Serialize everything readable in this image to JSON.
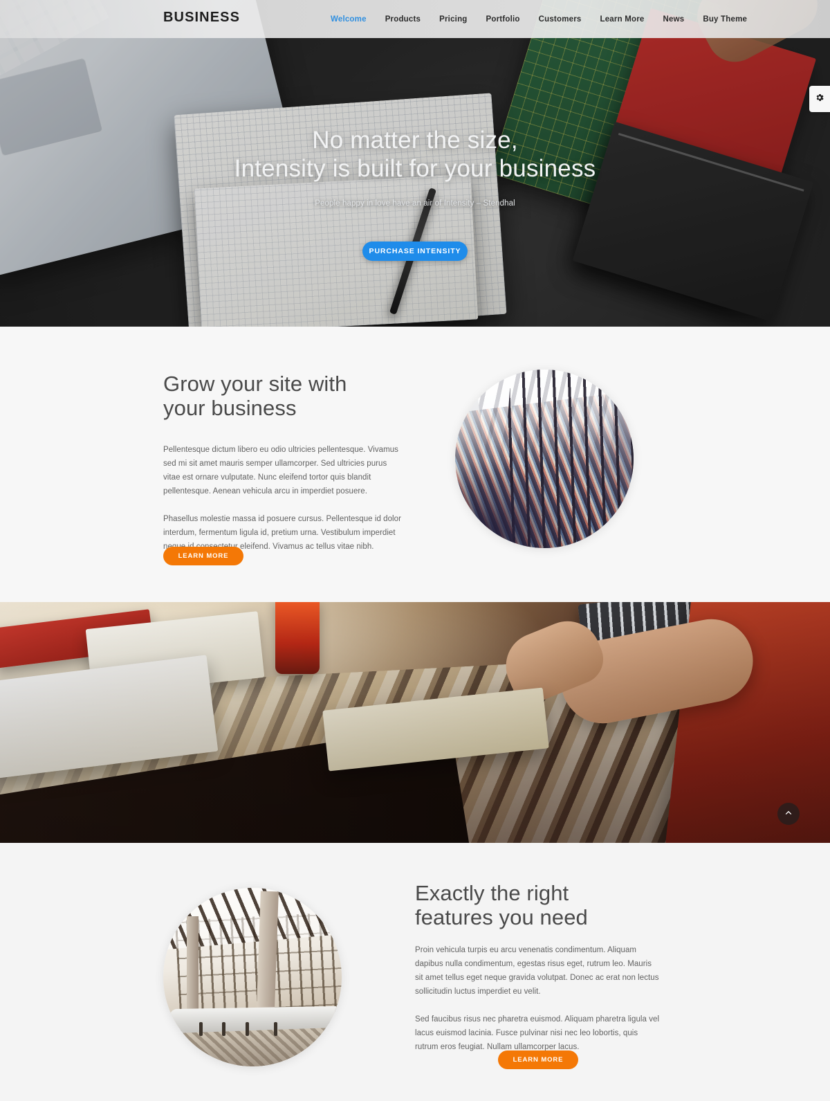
{
  "header": {
    "brand": "BUSINESS",
    "nav": [
      {
        "label": "Welcome",
        "active": true
      },
      {
        "label": "Products",
        "active": false
      },
      {
        "label": "Pricing",
        "active": false
      },
      {
        "label": "Portfolio",
        "active": false
      },
      {
        "label": "Customers",
        "active": false
      },
      {
        "label": "Learn More",
        "active": false
      },
      {
        "label": "News",
        "active": false
      },
      {
        "label": "Buy Theme",
        "active": false
      }
    ]
  },
  "hero": {
    "title_line1": "No matter the size,",
    "title_line2": "Intensity is built for your business",
    "subtitle": "People happy in love have an air of Intensity – Stendhal",
    "cta_label": "PURCHASE INTENSITY"
  },
  "settings": {
    "icon": "gear-icon"
  },
  "scroll_top": {
    "icon": "chevron-up-icon"
  },
  "grow": {
    "heading_line1": "Grow your site with",
    "heading_line2": "your business",
    "paragraph1": "Pellentesque dictum libero eu odio ultricies pellentesque. Vivamus sed mi sit amet mauris semper ullamcorper. Sed ultricies purus vitae est ornare vulputate. Nunc eleifend tortor quis blandit pellentesque. Aenean vehicula arcu in imperdiet posuere.",
    "paragraph2": "Phasellus molestie massa id posuere cursus. Pellentesque id dolor interdum, fermentum ligula id, pretium urna. Vestibulum imperdiet neque id consectetur eleifend. Vivamus ac tellus vitae nibh.",
    "cta_label": "LEARN MORE",
    "image_alt": "library-photo"
  },
  "band": {
    "image_alt": "desk-workspace-photo"
  },
  "features": {
    "heading_line1": "Exactly the right",
    "heading_line2": "features you need",
    "paragraph1": "Proin vehicula turpis eu arcu venenatis condimentum. Aliquam dapibus nulla condimentum, egestas risus eget, rutrum leo. Mauris sit amet tellus eget neque gravida volutpat. Donec ac erat non lectus sollicitudin luctus imperdiet eu velit.",
    "paragraph2": "Sed faucibus risus nec pharetra euismod. Aliquam pharetra ligula vel lacus euismod lacinia. Fusce pulvinar nisi nec leo lobortis, quis rutrum eros feugiat. Nullam ullamcorper lacus.",
    "cta_label": "LEARN MORE",
    "image_alt": "train-station-photo"
  },
  "colors": {
    "accent_blue": "#1f8cea",
    "accent_orange": "#f47806",
    "nav_active": "#2f8fe0",
    "section_bg_light": "#f7f7f7",
    "section_bg_grey": "#f4f4f4"
  }
}
